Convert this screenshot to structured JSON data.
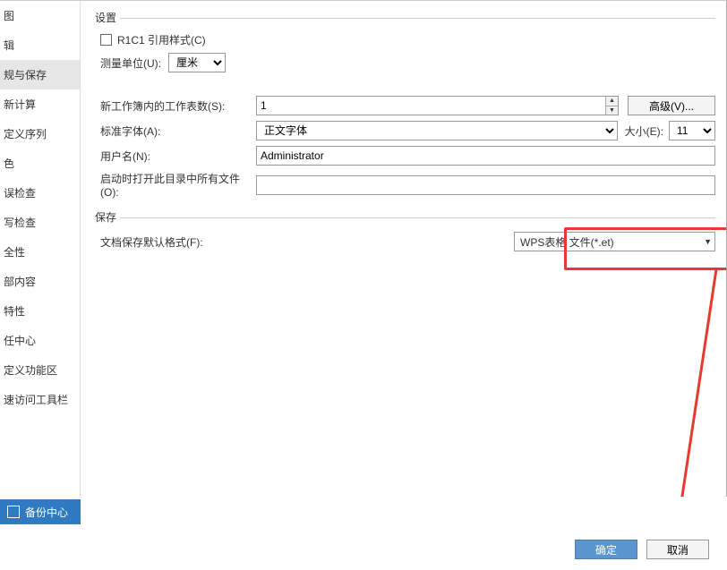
{
  "sidebar": {
    "items": [
      {
        "label": "图"
      },
      {
        "label": "辑"
      },
      {
        "label": "规与保存"
      },
      {
        "label": "新计算"
      },
      {
        "label": "定义序列"
      },
      {
        "label": "色"
      },
      {
        "label": "误检查"
      },
      {
        "label": "写检查"
      },
      {
        "label": "全性"
      },
      {
        "label": "部内容"
      },
      {
        "label": "特性"
      },
      {
        "label": "任中心"
      },
      {
        "label": "定义功能区"
      },
      {
        "label": "速访问工具栏"
      }
    ],
    "selected_index": 2
  },
  "settings_group": {
    "title": "设置",
    "r1c1_label": "R1C1 引用样式(C)",
    "unit_label": "测量单位(U):",
    "unit_value": "厘米"
  },
  "workbook": {
    "sheets_label": "新工作簿内的工作表数(S):",
    "sheets_value": "1",
    "advanced_label": "高级(V)...",
    "font_label": "标准字体(A):",
    "font_value": "正文字体",
    "size_label": "大小(E):",
    "size_value": "11",
    "username_label": "用户名(N):",
    "username_value": "Administrator",
    "openall_label": "启动时打开此目录中所有文件(O):",
    "openall_value": ""
  },
  "save_group": {
    "title": "保存",
    "default_format_label": "文档保存默认格式(F):",
    "default_format_value": "WPS表格 文件(*.et)"
  },
  "backup_center": "备份中心",
  "footer": {
    "ok": "确定",
    "cancel": "取消"
  }
}
